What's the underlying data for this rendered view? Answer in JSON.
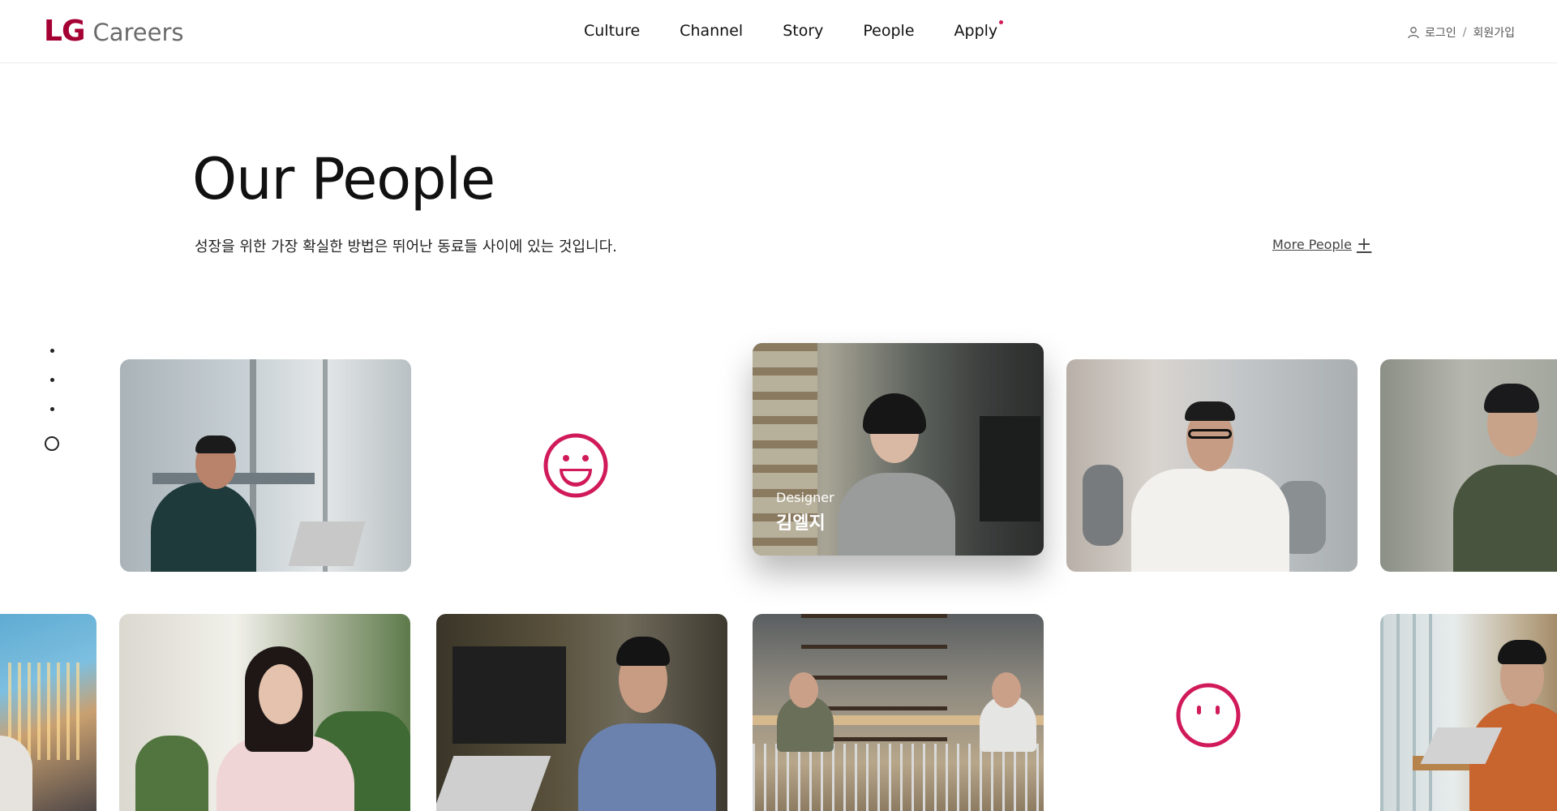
{
  "header": {
    "logo_lg": "LG",
    "logo_careers": "Careers",
    "nav": [
      "Culture",
      "Channel",
      "Story",
      "People",
      "Apply"
    ],
    "login": "로그인",
    "separator": "/",
    "signup": "회원가입"
  },
  "hero": {
    "title": "Our People",
    "subtitle": "성장을 위한 가장 확실한 방법은 뛰어난 동료들 사이에 있는 것입니다.",
    "more_link": "More People",
    "more_icon": "+"
  },
  "featured": {
    "role": "Designer",
    "name": "김엘지"
  },
  "colors": {
    "brand": "#a50034",
    "accent": "#d11a5a"
  },
  "pager": {
    "count": 4,
    "active_index": 3
  }
}
